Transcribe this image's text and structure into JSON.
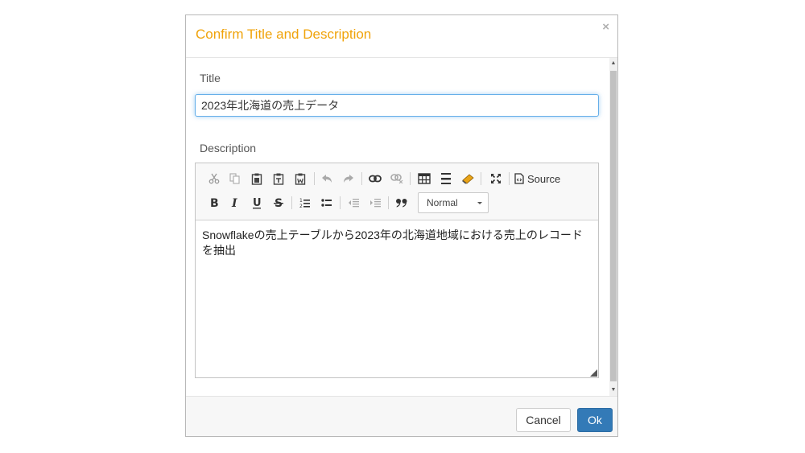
{
  "dialog": {
    "title": "Confirm Title and Description",
    "close_label": "×"
  },
  "form": {
    "title_label": "Title",
    "title_value": "2023年北海道の売上データ",
    "description_label": "Description"
  },
  "editor": {
    "toolbar_row1": [
      "cut",
      "copy",
      "paste",
      "paste-as-text",
      "paste-from-word",
      "undo",
      "redo",
      "link",
      "unlink",
      "table",
      "horizontal-line",
      "special-character",
      "maximize",
      "source"
    ],
    "source_label": "Source",
    "toolbar_row2": [
      "bold",
      "italic",
      "underline",
      "strikethrough",
      "numbered-list",
      "bulleted-list",
      "decrease-indent",
      "increase-indent",
      "blockquote"
    ],
    "format_value": "Normal",
    "content": "Snowflakeの売上テーブルから2023年の北海道地域における売上のレコードを抽出"
  },
  "footer": {
    "cancel_label": "Cancel",
    "ok_label": "Ok"
  },
  "colors": {
    "title": "#f0a30a",
    "primary": "#337ab7",
    "focus": "#66afe9"
  }
}
